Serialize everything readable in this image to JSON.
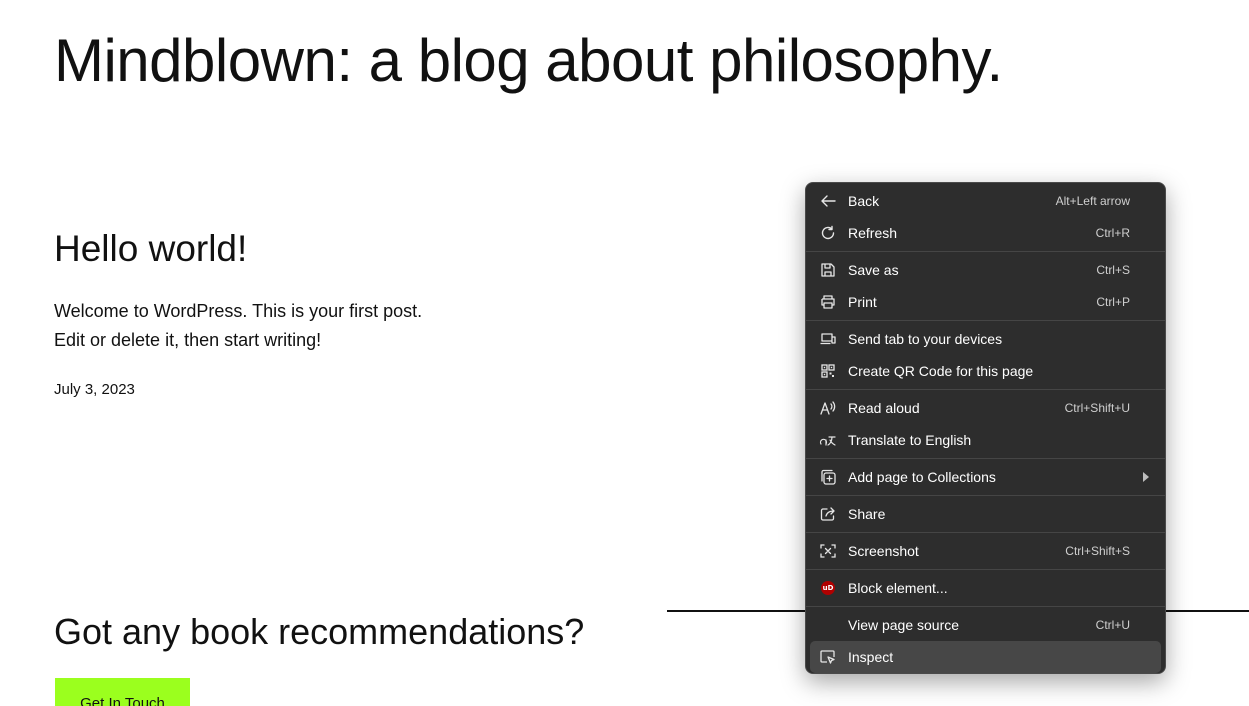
{
  "site": {
    "title": "Mindblown: a blog about philosophy."
  },
  "post": {
    "title": "Hello world!",
    "body_line1": "Welcome to WordPress. This is your first post.",
    "body_line2": "Edit or delete it, then start writing!",
    "date": "July 3, 2023"
  },
  "cta": {
    "heading": "Got any book recommendations?",
    "button_label": "Get In Touch",
    "button_color": "#9bff1e"
  },
  "context_menu": {
    "background": "#2d2d2d",
    "items": {
      "back": {
        "label": "Back",
        "shortcut": "Alt+Left arrow",
        "icon": "arrow-left-icon"
      },
      "refresh": {
        "label": "Refresh",
        "shortcut": "Ctrl+R",
        "icon": "refresh-icon"
      },
      "save_as": {
        "label": "Save as",
        "shortcut": "Ctrl+S",
        "icon": "save-icon"
      },
      "print": {
        "label": "Print",
        "shortcut": "Ctrl+P",
        "icon": "printer-icon"
      },
      "send_tab": {
        "label": "Send tab to your devices",
        "icon": "devices-icon"
      },
      "qr_code": {
        "label": "Create QR Code for this page",
        "icon": "qr-code-icon"
      },
      "read_aloud": {
        "label": "Read aloud",
        "shortcut": "Ctrl+Shift+U",
        "icon": "read-aloud-icon"
      },
      "translate": {
        "label": "Translate to English",
        "icon": "translate-icon"
      },
      "collections": {
        "label": "Add page to Collections",
        "icon": "collections-icon"
      },
      "share": {
        "label": "Share",
        "icon": "share-icon"
      },
      "screenshot": {
        "label": "Screenshot",
        "shortcut": "Ctrl+Shift+S",
        "icon": "screenshot-icon"
      },
      "block_element": {
        "label": "Block element...",
        "icon": "ublock-icon"
      },
      "view_source": {
        "label": "View page source",
        "shortcut": "Ctrl+U"
      },
      "inspect": {
        "label": "Inspect",
        "icon": "inspect-icon",
        "highlighted": true
      }
    }
  }
}
